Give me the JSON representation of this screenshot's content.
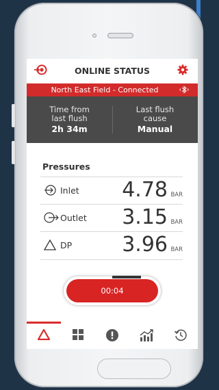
{
  "header": {
    "title": "ONLINE STATUS",
    "left_icon": "flush-target-icon",
    "right_icon": "gear-icon"
  },
  "banner": {
    "text": "North East Field - Connected",
    "icon": "bluetooth-icon"
  },
  "stats": {
    "left_label": "Time from last flush",
    "left_value": "2h 34m",
    "right_label": "Last flush cause",
    "right_value": "Manual"
  },
  "pressures": {
    "title": "Pressures",
    "rows": [
      {
        "label": "Inlet",
        "value": "4.78",
        "unit": "BAR",
        "icon": "inlet-arrow-icon"
      },
      {
        "label": "Outlet",
        "value": "3.15",
        "unit": "BAR",
        "icon": "outlet-arrow-icon"
      },
      {
        "label": "DP",
        "value": "3.96",
        "unit": "BAR",
        "icon": "delta-icon"
      }
    ]
  },
  "timer": {
    "label": "00:04"
  },
  "nav": {
    "items": [
      {
        "icon": "delta-status-icon",
        "active": true
      },
      {
        "icon": "grid-icon",
        "active": false
      },
      {
        "icon": "alert-icon",
        "active": false
      },
      {
        "icon": "chart-icon",
        "active": false
      },
      {
        "icon": "history-icon",
        "active": false
      }
    ]
  },
  "colors": {
    "accent": "#d92b2b",
    "dark_panel": "#4a4a4a",
    "background": "#1f3347"
  }
}
